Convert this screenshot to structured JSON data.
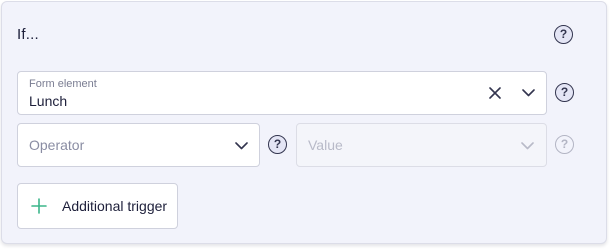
{
  "condition": {
    "title": "If...",
    "help_symbol": "?",
    "form_element": {
      "label": "Form element",
      "value": "Lunch",
      "clear_icon": "close-icon",
      "dropdown_icon": "chevron-down-icon"
    },
    "operator": {
      "placeholder": "Operator",
      "dropdown_icon": "chevron-down-icon"
    },
    "value_field": {
      "placeholder": "Value",
      "disabled": true,
      "dropdown_icon": "chevron-down-icon"
    },
    "add_trigger": {
      "label": "Additional trigger",
      "icon": "plus-icon"
    }
  },
  "colors": {
    "panel_background": "#f2f3fb",
    "text": "#1d1f3a",
    "plus_accent": "#3bb58a",
    "disabled": "#b8bac8"
  }
}
